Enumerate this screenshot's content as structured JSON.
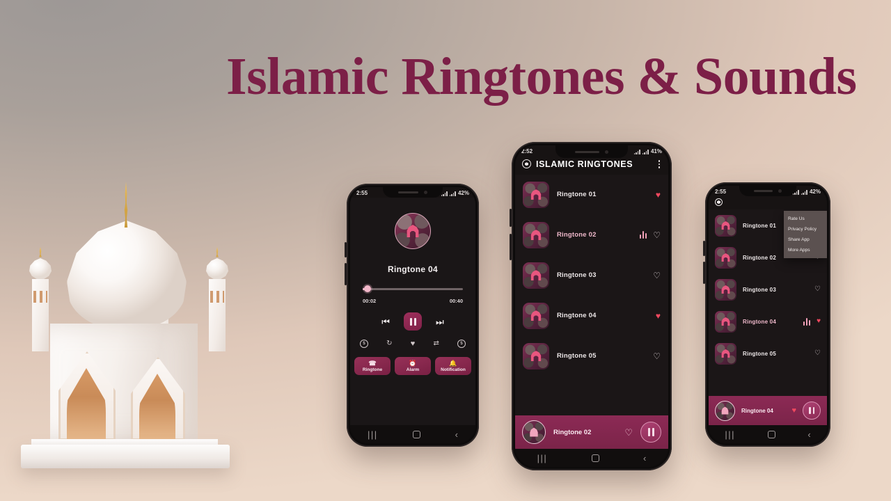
{
  "hero": {
    "title": "Islamic Ringtones & Sounds",
    "title_color": "#7c1f47",
    "background_colors": [
      "#9d9896",
      "#c6b4a8",
      "#e9d4c4"
    ],
    "illustration": "mosque-3d-illustration"
  },
  "player_phone": {
    "status": {
      "time": "2:55",
      "battery": "42%"
    },
    "album_art_icon": "mosque-arch-icon",
    "track_title": "Ringtone 04",
    "progress": {
      "current": "00:02",
      "total": "00:40",
      "percent": 5
    },
    "transport": {
      "previous": "skip-previous-icon",
      "play_pause": "pause-icon",
      "next": "skip-next-icon"
    },
    "extras": [
      {
        "name": "replay-5-icon",
        "label": "5"
      },
      {
        "name": "repeat-icon",
        "label": "↻"
      },
      {
        "name": "favorite-heart-icon",
        "label": "♥"
      },
      {
        "name": "shuffle-icon",
        "label": "⇄"
      },
      {
        "name": "forward-5-icon",
        "label": "5"
      }
    ],
    "actions": [
      {
        "label": "Ringtone",
        "icon": "phone-ring-icon",
        "glyph": "☎"
      },
      {
        "label": "Alarm",
        "icon": "alarm-clock-icon",
        "glyph": "⏰"
      },
      {
        "label": "Notification",
        "icon": "bell-icon",
        "glyph": "🔔"
      }
    ],
    "navbar": {
      "recents": "|||",
      "home": "home-square-icon",
      "back": "‹"
    }
  },
  "list_phone": {
    "status": {
      "time": "2:52",
      "battery": "41%"
    },
    "header": {
      "logo_icon": "record-target-icon",
      "title": "ISLAMIC RINGTONES",
      "menu_icon": "kebab-menu-icon"
    },
    "items": [
      {
        "name": "Ringtone 01",
        "favorite": true,
        "playing": false
      },
      {
        "name": "Ringtone 02",
        "favorite": false,
        "playing": true
      },
      {
        "name": "Ringtone 03",
        "favorite": false,
        "playing": false
      },
      {
        "name": "Ringtone 04",
        "favorite": true,
        "playing": false
      },
      {
        "name": "Ringtone 05",
        "favorite": false,
        "playing": false
      }
    ],
    "mini_player": {
      "track": "Ringtone 02",
      "favorite": false,
      "button": "pause-icon"
    },
    "navbar": {
      "recents": "|||",
      "home": "home-square-icon",
      "back": "‹"
    }
  },
  "menu_phone": {
    "status": {
      "time": "2:55",
      "battery": "42%"
    },
    "header": {
      "logo_icon": "record-target-icon"
    },
    "menu_items": [
      "Rate Us",
      "Privacy Policy",
      "Share App",
      "More Apps"
    ],
    "items": [
      {
        "name": "Ringtone 01",
        "favorite": false,
        "playing": false
      },
      {
        "name": "Ringtone 02",
        "favorite": false,
        "playing": false
      },
      {
        "name": "Ringtone 03",
        "favorite": false,
        "playing": false
      },
      {
        "name": "Ringtone 04",
        "favorite": true,
        "playing": true
      },
      {
        "name": "Ringtone 05",
        "favorite": false,
        "playing": false
      }
    ],
    "mini_player": {
      "track": "Ringtone 04",
      "favorite": true,
      "button": "pause-icon"
    },
    "navbar": {
      "recents": "|||",
      "home": "home-square-icon",
      "back": "‹"
    }
  }
}
